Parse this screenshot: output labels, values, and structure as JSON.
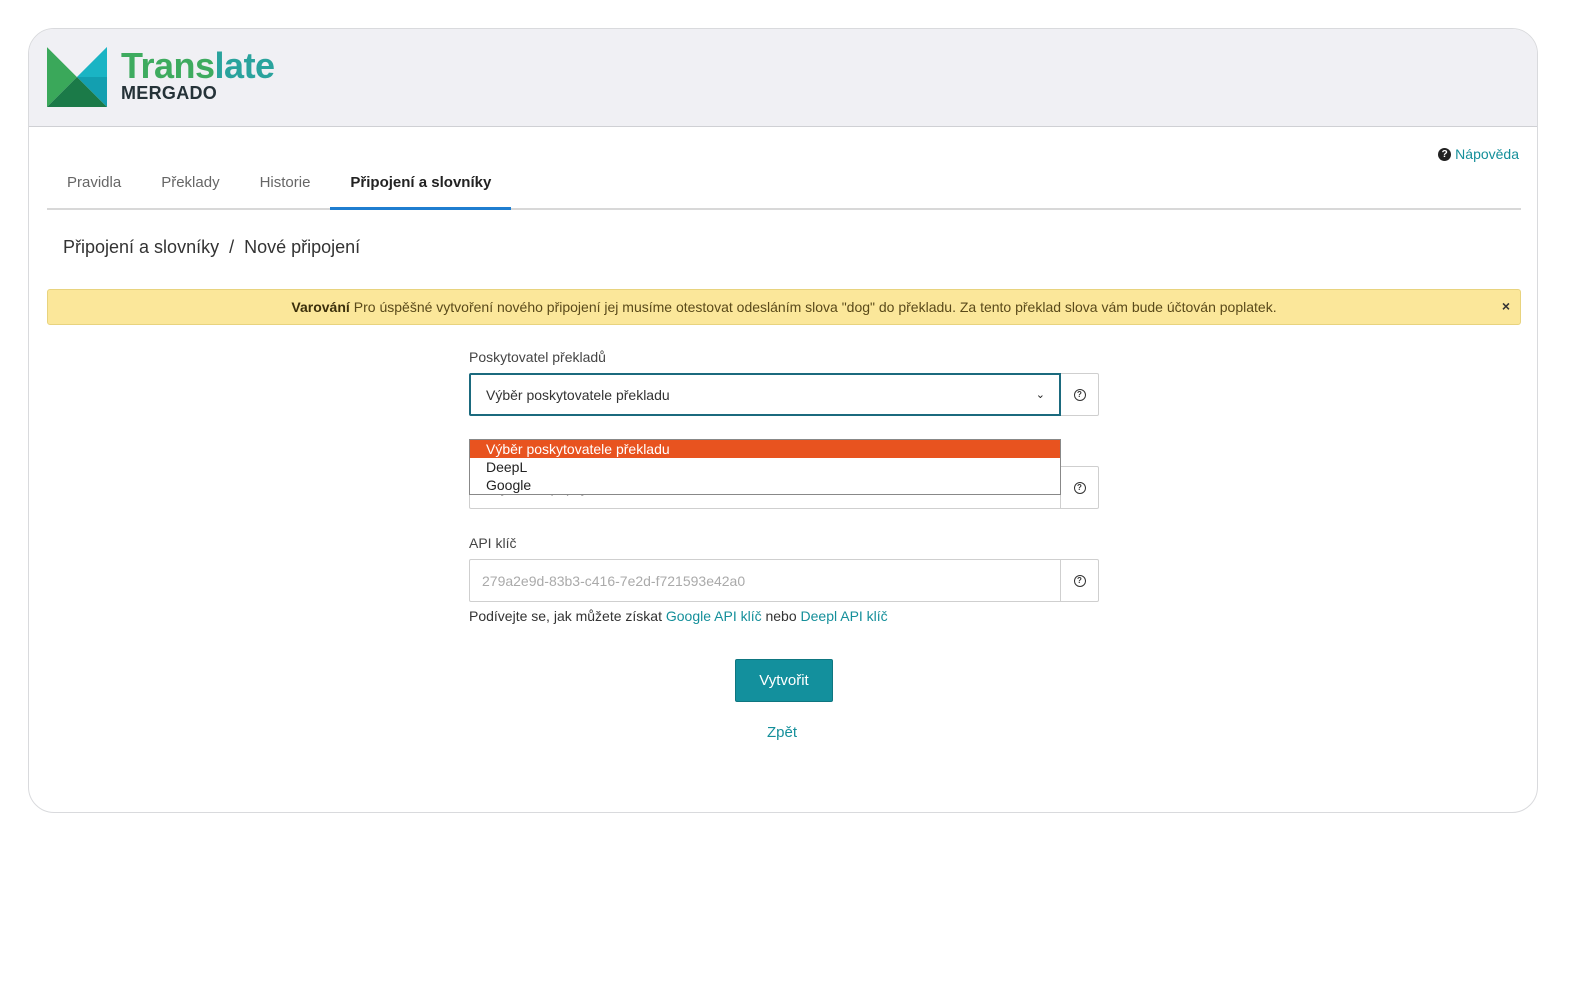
{
  "brand": {
    "title_part1": "Trans",
    "title_part2": "late",
    "subtitle": "MERGADO"
  },
  "help": {
    "label": "Nápověda"
  },
  "tabs": [
    {
      "label": "Pravidla",
      "active": false
    },
    {
      "label": "Překlady",
      "active": false
    },
    {
      "label": "Historie",
      "active": false
    },
    {
      "label": "Připojení a slovníky",
      "active": true
    }
  ],
  "breadcrumb": {
    "parent": "Připojení a slovníky",
    "separator": "/",
    "current": "Nové připojení"
  },
  "alert": {
    "strong": "Varování",
    "text": "Pro úspěšné vytvoření nového připojení jej musíme otestovat odesláním slova \"dog\" do překladu. Za tento překlad slova vám bude účtován poplatek.",
    "close": "×"
  },
  "form": {
    "provider": {
      "label": "Poskytovatel překladů",
      "selected": "Výběr poskytovatele překladu",
      "options": [
        "Výběr poskytovatele překladu",
        "DeepL",
        "Google"
      ]
    },
    "name": {
      "placeholder": "Moje nové připojení"
    },
    "api_key": {
      "label": "API klíč",
      "placeholder": "279a2e9d-83b3-c416-7e2d-f721593e42a0"
    },
    "hint": {
      "prefix": "Podívejte se, jak můžete získat",
      "google_link": "Google API klíč",
      "middle": "nebo",
      "deepl_link": "Deepl API klíč"
    },
    "submit": "Vytvořit",
    "back": "Zpět"
  },
  "colors": {
    "accent": "#13909d",
    "tab_active_underline": "#1f7ed0",
    "alert_bg": "#fbe79a",
    "dropdown_selected": "#e8531f"
  }
}
